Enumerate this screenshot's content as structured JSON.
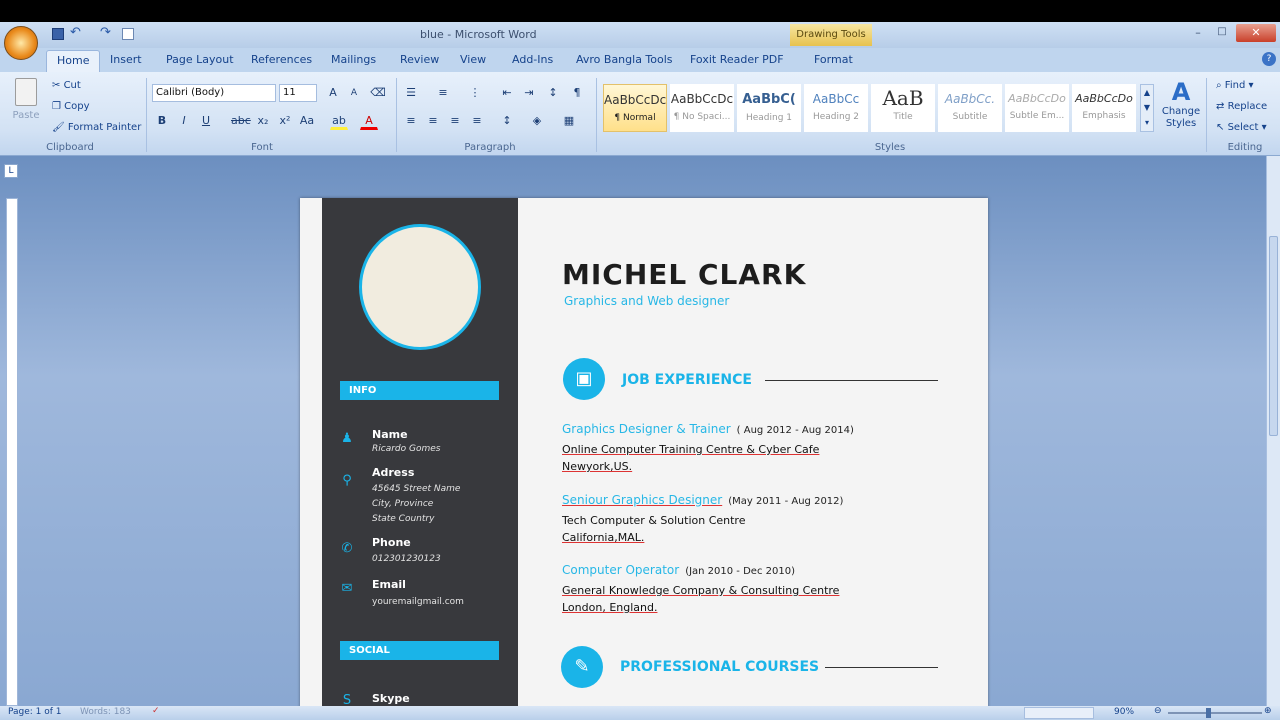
{
  "window": {
    "title": "blue - Microsoft Word",
    "context_tab": "Drawing Tools",
    "buttons": [
      "–",
      "□",
      "✕"
    ]
  },
  "ribbon_tabs": [
    {
      "label": "Home",
      "active": true
    },
    {
      "label": "Insert"
    },
    {
      "label": "Page Layout"
    },
    {
      "label": "References"
    },
    {
      "label": "Mailings"
    },
    {
      "label": "Review"
    },
    {
      "label": "View"
    },
    {
      "label": "Add-Ins"
    },
    {
      "label": "Avro Bangla Tools"
    },
    {
      "label": "Foxit Reader PDF"
    },
    {
      "label": "Format"
    }
  ],
  "clipboard": {
    "paste": "Paste",
    "cut": "Cut",
    "copy": "Copy",
    "format_painter": "Format Painter",
    "label": "Clipboard"
  },
  "font": {
    "name": "Calibri (Body)",
    "size": "11",
    "label": "Font"
  },
  "paragraph": {
    "label": "Paragraph"
  },
  "styles": {
    "label": "Styles",
    "items": [
      {
        "preview": "AaBbCcDc",
        "name": "¶ Normal"
      },
      {
        "preview": "AaBbCcDc",
        "name": "¶ No Spaci..."
      },
      {
        "preview": "AaBbC(",
        "name": "Heading 1"
      },
      {
        "preview": "AaBbCc",
        "name": "Heading 2"
      },
      {
        "preview": "AaB",
        "name": "Title"
      },
      {
        "preview": "AaBbCc.",
        "name": "Subtitle"
      },
      {
        "preview": "AaBbCcDo",
        "name": "Subtle Em..."
      },
      {
        "preview": "AaBbCcDo",
        "name": "Emphasis"
      }
    ],
    "change_styles": "Change Styles"
  },
  "editing": {
    "find": "Find",
    "replace": "Replace",
    "select": "Select",
    "label": "Editing"
  },
  "resume": {
    "name": "MICHEL CLARK",
    "subtitle": "Graphics and Web designer",
    "info_bar": "INFO",
    "social_bar": "SOCIAL",
    "info": [
      {
        "icon": "person-icon",
        "title": "Name",
        "value": "Ricardo Gomes"
      },
      {
        "icon": "location-pin-icon",
        "title": "Adress",
        "value": "45645 Street Name\nCity, Province\nState Country"
      },
      {
        "icon": "phone-icon",
        "title": "Phone",
        "value": "012301230123"
      },
      {
        "icon": "email-icon",
        "title": "Email",
        "value": "youremailgmail.com"
      }
    ],
    "social_first": "Skype",
    "job_section": "JOB EXPERIENCE",
    "jobs": [
      {
        "title": "Graphics Designer & Trainer",
        "date": "( Aug 2012 - Aug 2014)",
        "line1": "Online Computer Training Centre & Cyber Cafe",
        "line2": "Newyork,US."
      },
      {
        "title": "Seniour Graphics Designer",
        "date": "(May 2011 - Aug 2012)",
        "line1": "Tech Computer & Solution Centre",
        "line2": "California,MAL."
      },
      {
        "title": "Computer Operator",
        "date": "(Jan 2010 - Dec 2010)",
        "line1": "General Knowledge Company & Consulting Centre",
        "line2": "London, England."
      }
    ],
    "courses_section": "PROFESSIONAL COURSES"
  },
  "status": {
    "page": "Page: 1 of 1",
    "words": "Words: 183",
    "zoom": "90%"
  },
  "colors": {
    "accent": "#1ab4e8",
    "sidebar": "#38393d",
    "ribbon": "#d3e2f4"
  }
}
